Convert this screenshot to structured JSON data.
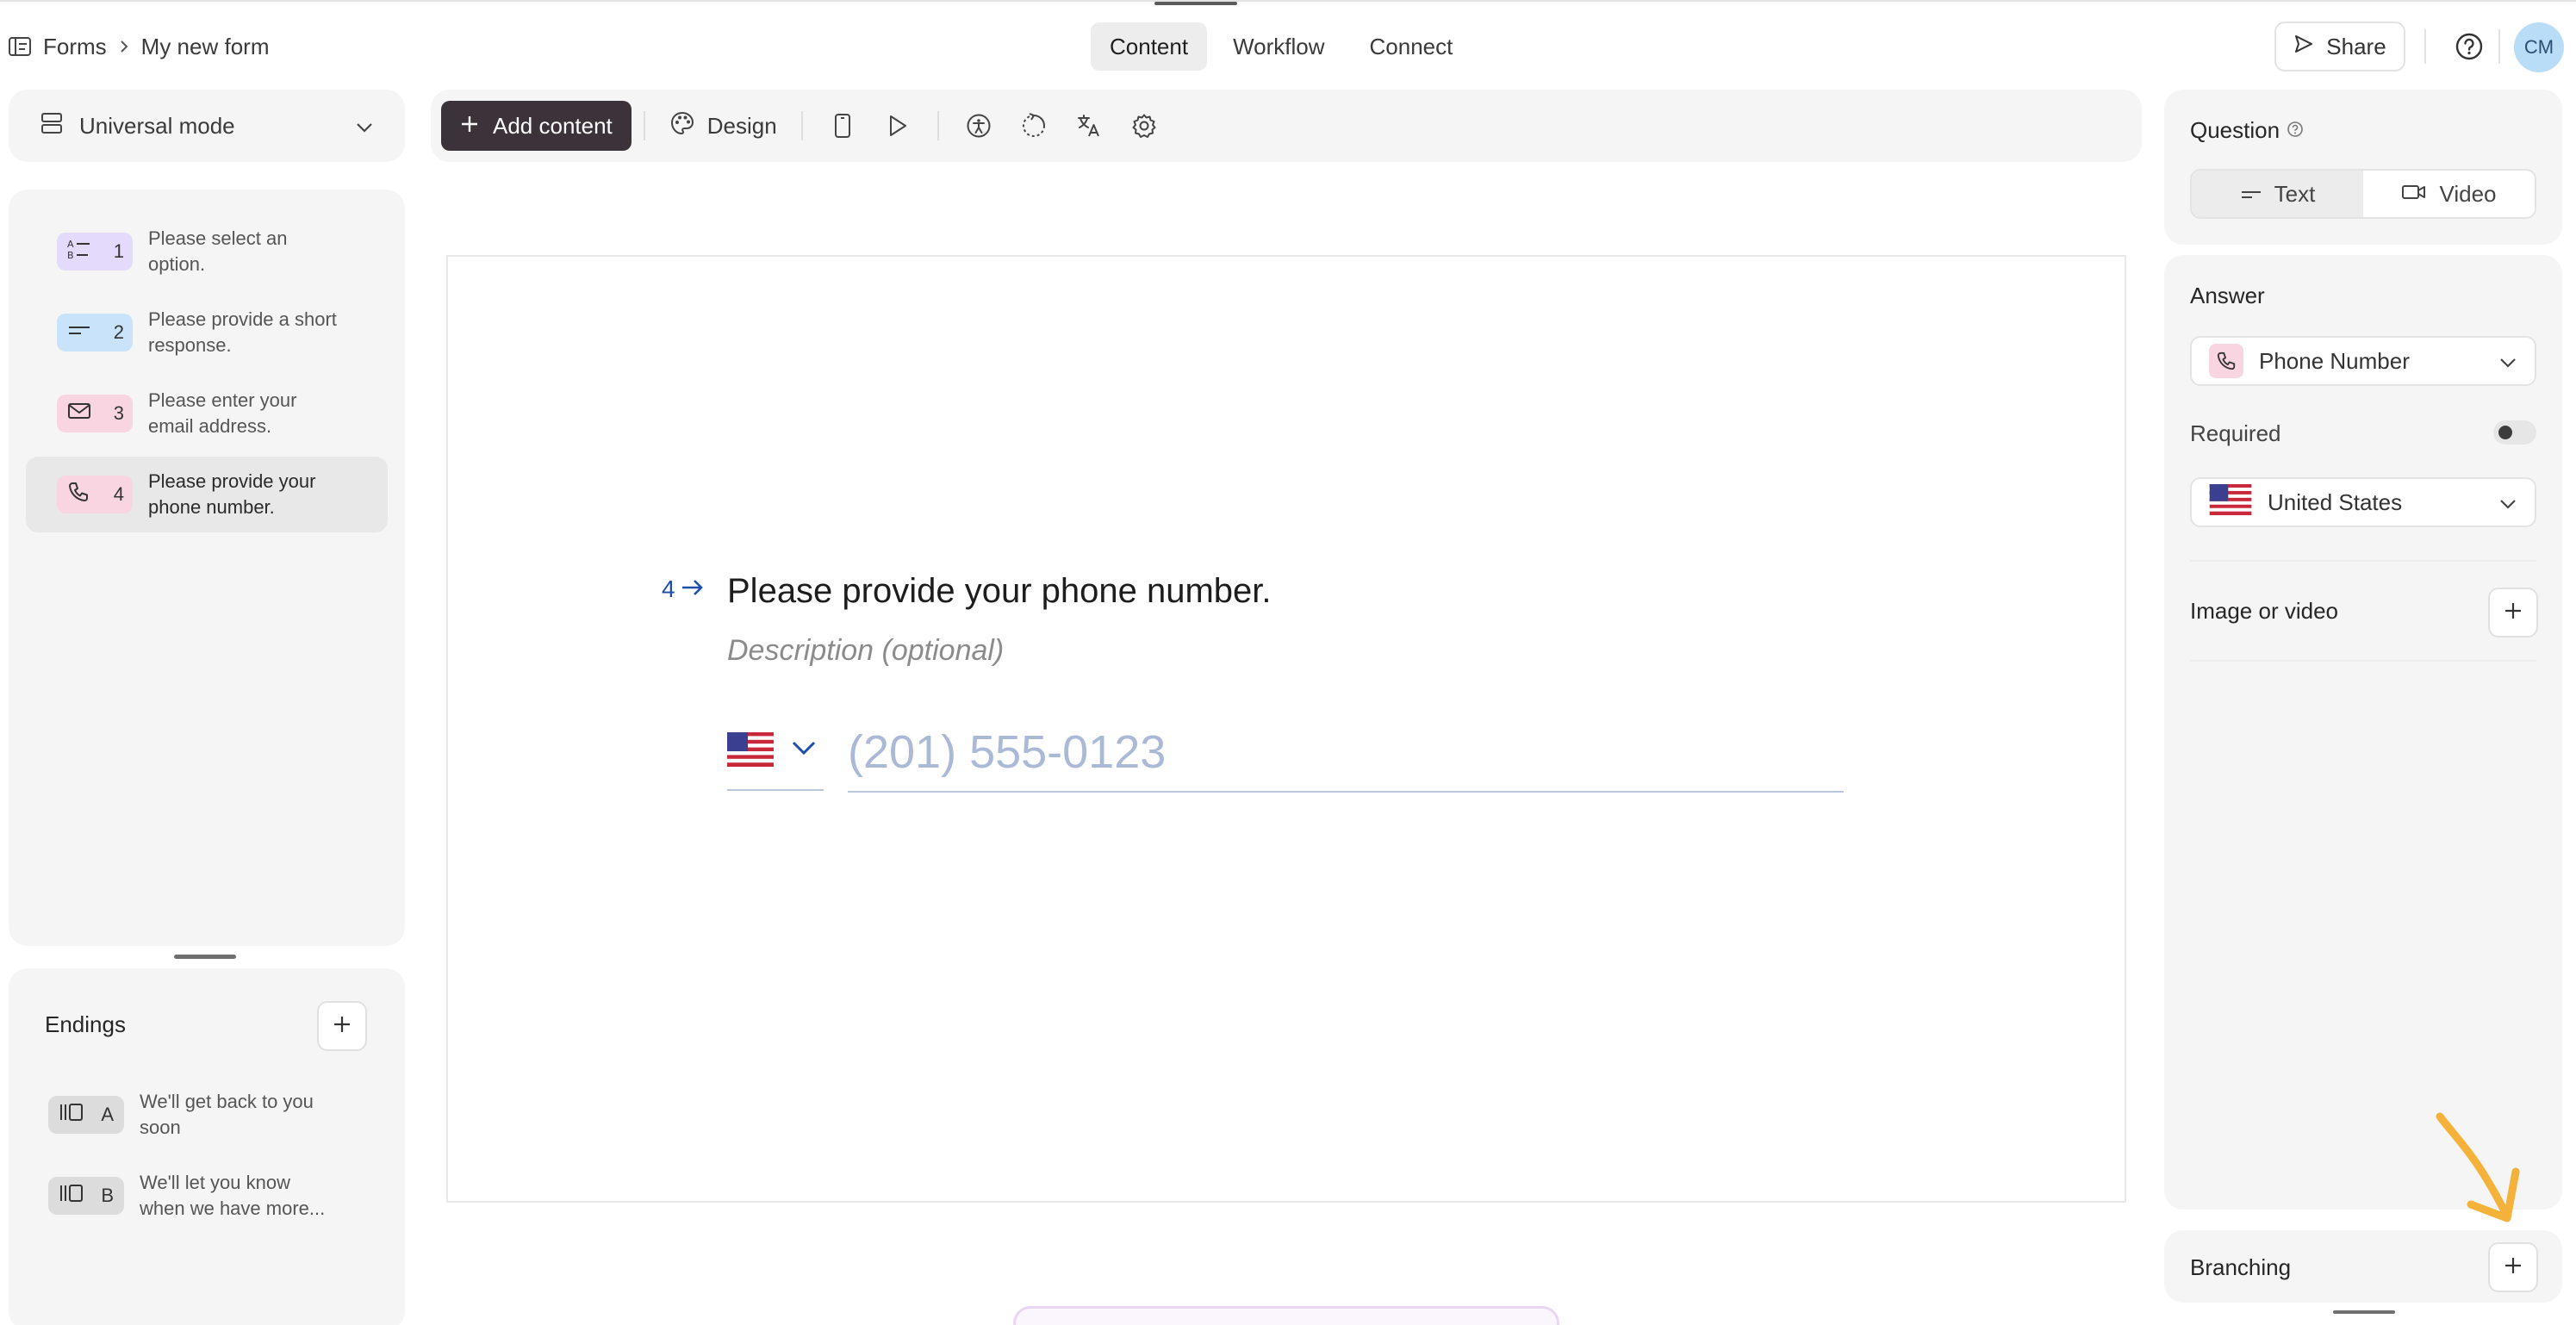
{
  "header": {
    "breadcrumb_root": "Forms",
    "breadcrumb_current": "My new form",
    "tabs": [
      {
        "label": "Content",
        "active": true
      },
      {
        "label": "Workflow",
        "active": false
      },
      {
        "label": "Connect",
        "active": false
      }
    ],
    "share_label": "Share",
    "avatar_initials": "CM"
  },
  "sidebar": {
    "mode_label": "Universal mode",
    "questions": [
      {
        "number": "1",
        "text": "Please select an option.",
        "type_icon": "multiple-choice-icon",
        "color": "#e4dafc"
      },
      {
        "number": "2",
        "text": "Please provide a short response.",
        "type_icon": "short-text-icon",
        "color": "#c9e3fb"
      },
      {
        "number": "3",
        "text": "Please enter your email address.",
        "type_icon": "email-icon",
        "color": "#f9d5e2"
      },
      {
        "number": "4",
        "text": "Please provide your phone number.",
        "type_icon": "phone-icon",
        "color": "#f9d5e2",
        "selected": true
      }
    ],
    "endings_title": "Endings",
    "endings": [
      {
        "letter": "A",
        "text": "We'll get back to you soon"
      },
      {
        "letter": "B",
        "text": "We'll let you know when we have more..."
      }
    ]
  },
  "toolbar": {
    "add_content_label": "Add content",
    "design_label": "Design",
    "icons": [
      "mobile-preview-icon",
      "play-icon",
      "accessibility-icon",
      "loader-icon",
      "translate-icon",
      "settings-icon"
    ]
  },
  "canvas": {
    "question_number": "4",
    "question_title": "Please provide your phone number.",
    "description_placeholder": "Description (optional)",
    "phone_placeholder": "(201) 555-0123"
  },
  "right_panel": {
    "question_label": "Question",
    "question_modes": [
      {
        "label": "Text",
        "active": true
      },
      {
        "label": "Video",
        "active": false
      }
    ],
    "answer_label": "Answer",
    "answer_type": "Phone Number",
    "required_label": "Required",
    "required": false,
    "country": "United States",
    "image_video_label": "Image or video",
    "branching_label": "Branching"
  },
  "colors": {
    "accent_dark": "#3b3339",
    "question_link": "#1e4ea8",
    "annotation_arrow": "#f5b23a"
  }
}
